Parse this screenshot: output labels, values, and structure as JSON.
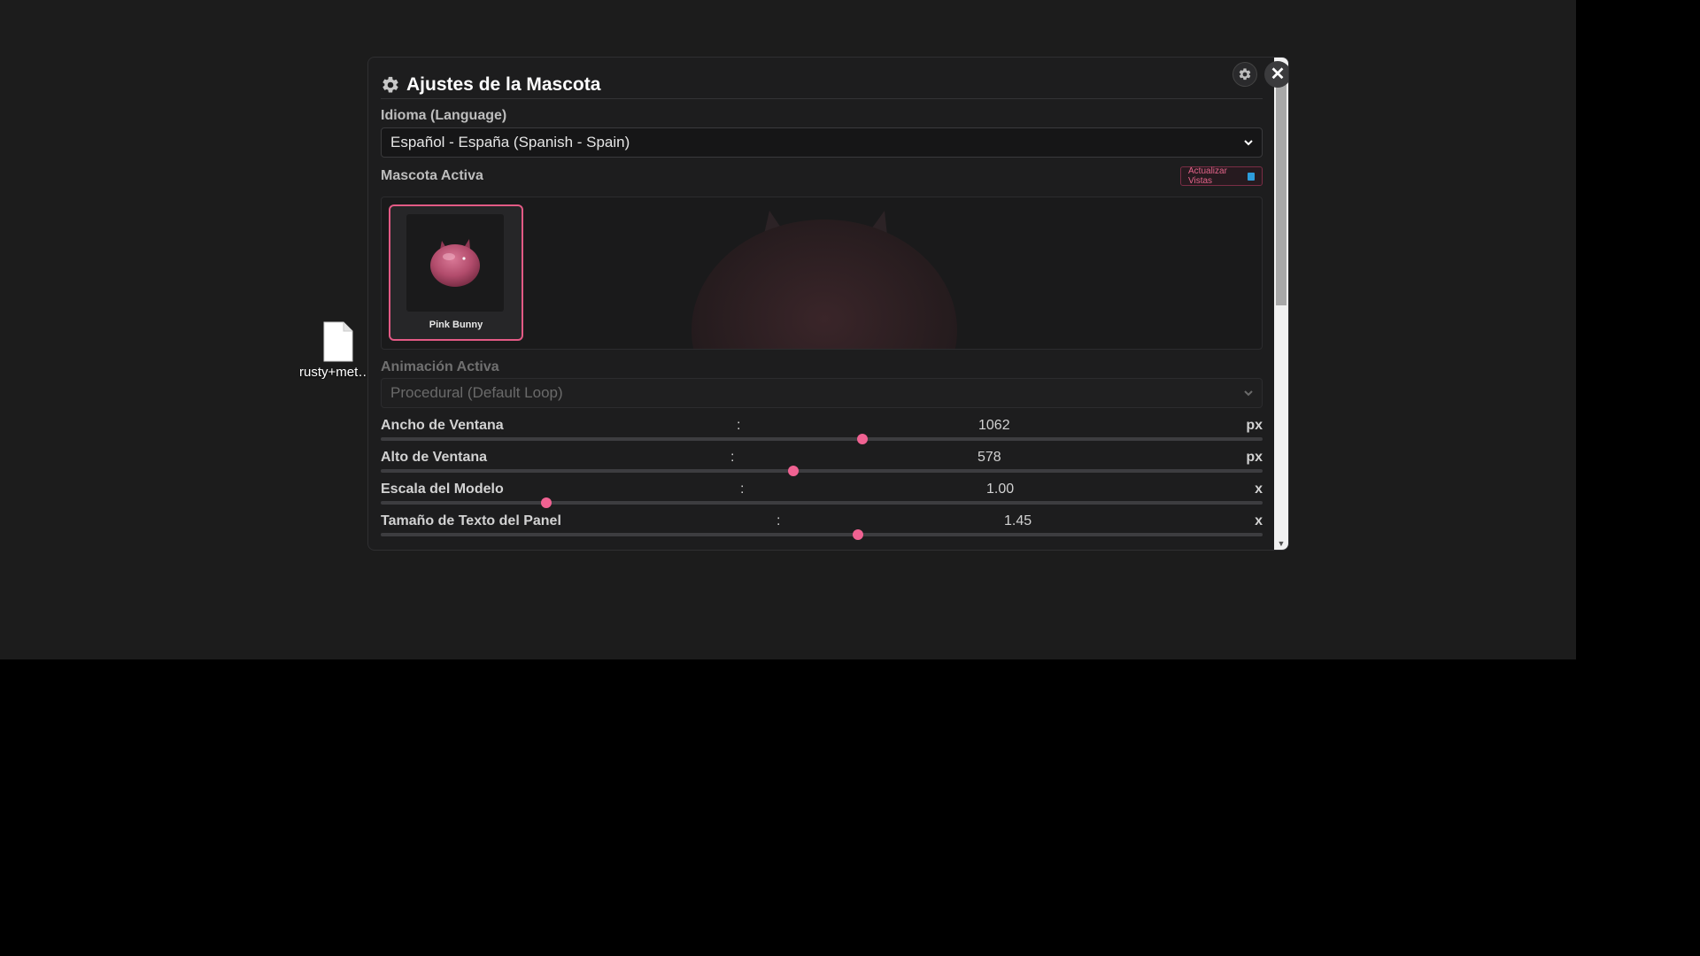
{
  "desktop": {
    "file_name": "rusty+metal..."
  },
  "window": {
    "title": "Ajustes de la Mascota",
    "close_label": "✕"
  },
  "language": {
    "label": "Idioma (Language)",
    "selected": "Español - España (Spanish - Spain)"
  },
  "pet": {
    "label": "Mascota Activa",
    "refresh_label": "Actualizar Vistas",
    "items": [
      {
        "name": "Pink Bunny",
        "selected": true
      }
    ]
  },
  "animation": {
    "label": "Animación Activa",
    "selected": "Procedural (Default Loop)",
    "disabled": true
  },
  "sliders": [
    {
      "label": "Ancho de Ventana",
      "colon": ":",
      "value": "1062",
      "unit": "px",
      "fraction": 0.546
    },
    {
      "label": "Alto de Ventana",
      "colon": ":",
      "value": "578",
      "unit": "px",
      "fraction": 0.468
    },
    {
      "label": "Escala del Modelo",
      "colon": ":",
      "value": "1.00",
      "unit": "x",
      "fraction": 0.188
    },
    {
      "label": "Tamaño de Texto del Panel",
      "colon": ":",
      "value": "1.45",
      "unit": "x",
      "fraction": 0.541
    }
  ],
  "colors": {
    "accent": "#f06292",
    "window_bg": "#1d1d1e",
    "desktop_bg": "#1c1c1c"
  }
}
